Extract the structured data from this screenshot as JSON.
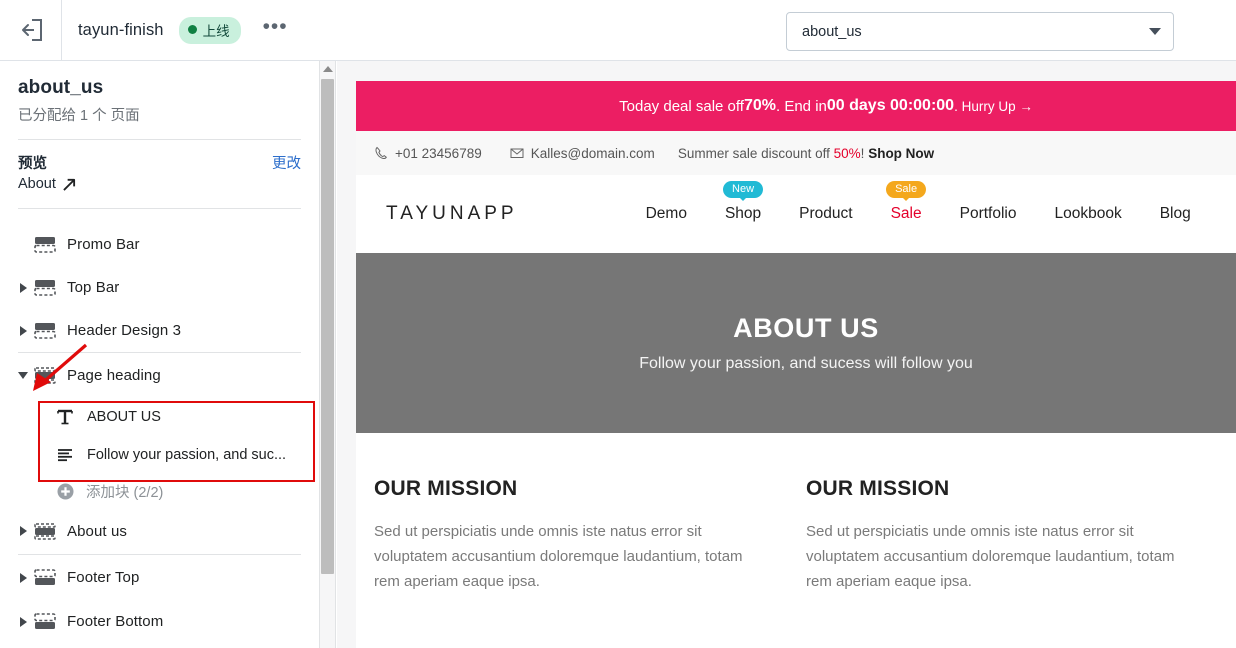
{
  "topbar": {
    "back_icon": "exit-back-icon",
    "project_name": "tayun-finish",
    "status_label": "上线",
    "more_label": "•••",
    "page_select_value": "about_us",
    "page_select_caret": "chevron-down-icon"
  },
  "sidebar": {
    "title": "about_us",
    "subtitle": "已分配给 1 个 页面",
    "preview_label": "预览",
    "change_label": "更改",
    "preview_page": "About",
    "external_icon": "external-link-icon",
    "nodes": [
      {
        "label": "Promo Bar",
        "expandable": false,
        "expanded": false,
        "icon": "section-top-solid-icon"
      },
      {
        "label": "Top Bar",
        "expandable": true,
        "expanded": false,
        "icon": "section-top-solid-icon"
      },
      {
        "label": "Header Design 3",
        "expandable": true,
        "expanded": false,
        "icon": "section-top-solid-icon"
      },
      {
        "label": "Page heading",
        "expandable": true,
        "expanded": true,
        "icon": "section-full-solid-icon"
      },
      {
        "label": "About us",
        "expandable": true,
        "expanded": false,
        "icon": "section-middle-solid-icon"
      },
      {
        "label": "Footer Top",
        "expandable": true,
        "expanded": false,
        "icon": "section-bottom-solid-icon"
      },
      {
        "label": "Footer Bottom",
        "expandable": true,
        "expanded": false,
        "icon": "section-bottom-solid-icon"
      }
    ],
    "children": [
      {
        "label": "ABOUT US",
        "icon": "text-block-icon"
      },
      {
        "label": "Follow your passion, and suc...",
        "icon": "richtext-block-icon"
      }
    ],
    "add_block_label": "添加块 (2/2)",
    "add_block_icon": "plus-circle-icon",
    "highlight_color": "#e00b0b"
  },
  "scrollbar": {
    "up_arrow_icon": "triangle-up-icon",
    "thumb": "scrollbar-thumb"
  },
  "preview": {
    "promo": {
      "prefix": "Today deal sale off ",
      "percent": "70%",
      "middle": " . End in ",
      "countdown": "00 days 00:00:00",
      "suffix": ". Hurry Up →",
      "bg_color": "#ec1e63"
    },
    "infobar": {
      "phone_icon": "phone-icon",
      "phone": "+01 23456789",
      "email_icon": "envelope-icon",
      "email": "Kalles@domain.com",
      "center_prefix": "Summer sale discount off ",
      "center_percent": "50%",
      "center_mid": "! ",
      "center_cta": "Shop Now"
    },
    "nav": {
      "brand": "TAYUNAPP",
      "items": [
        {
          "label": "Demo",
          "badge": null,
          "sale": false
        },
        {
          "label": "Shop",
          "badge": "New",
          "sale": false
        },
        {
          "label": "Product",
          "badge": null,
          "sale": false
        },
        {
          "label": "Sale",
          "badge": "Sale",
          "sale": true
        },
        {
          "label": "Portfolio",
          "badge": null,
          "sale": false
        },
        {
          "label": "Lookbook",
          "badge": null,
          "sale": false
        },
        {
          "label": "Blog",
          "badge": null,
          "sale": false
        }
      ]
    },
    "hero": {
      "title": "ABOUT US",
      "subtitle": "Follow your passion, and sucess will follow you",
      "bg_color": "#767676"
    },
    "mission": {
      "left_title": "OUR MISSION",
      "left_text": "Sed ut perspiciatis unde omnis iste natus error sit voluptatem accusantium doloremque laudantium, totam rem aperiam eaque ipsa.",
      "right_title": "OUR MISSION",
      "right_text": "Sed ut perspiciatis unde omnis iste natus error sit voluptatem accusantium doloremque laudantium, totam rem aperiam eaque ipsa."
    }
  }
}
